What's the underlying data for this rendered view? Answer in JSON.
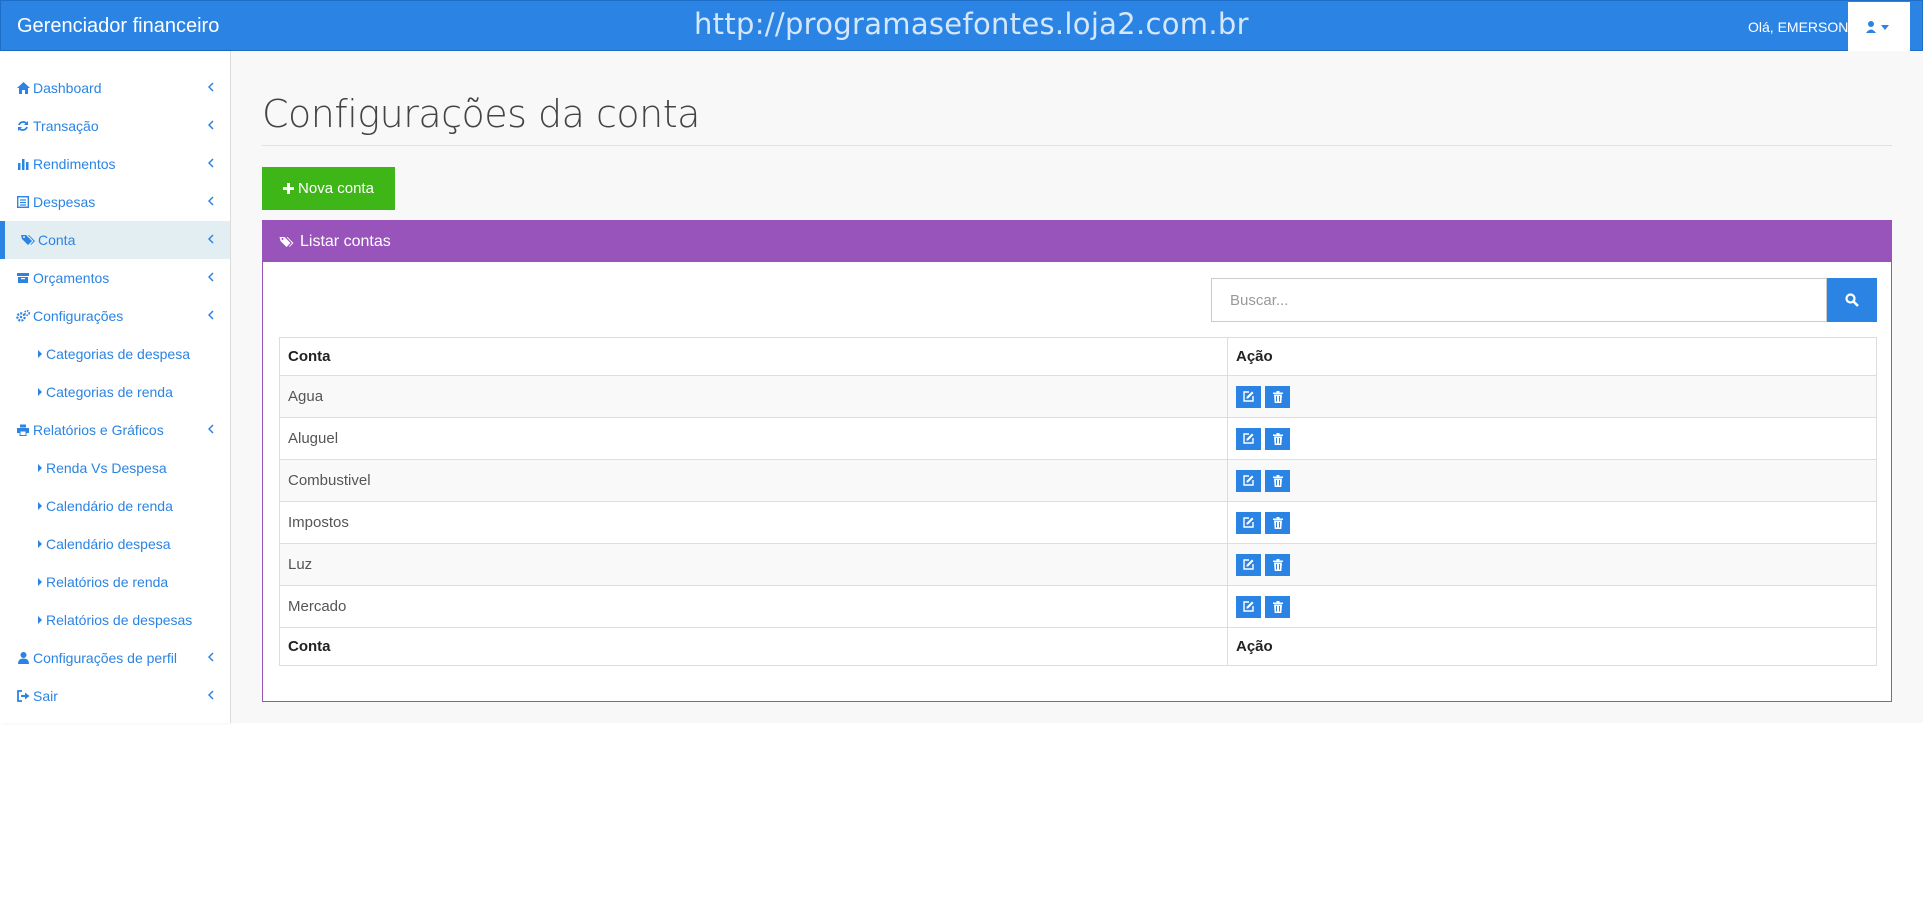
{
  "header": {
    "brand": "Gerenciador financeiro",
    "watermark": "http://programasefontes.loja2.com.br",
    "greeting": "Olá, EMERSON"
  },
  "sidebar": {
    "items": [
      {
        "label": "Dashboard",
        "icon": "home-icon"
      },
      {
        "label": "Transação",
        "icon": "refresh-icon"
      },
      {
        "label": "Rendimentos",
        "icon": "bar-chart-icon"
      },
      {
        "label": "Despesas",
        "icon": "list-icon"
      },
      {
        "label": "Conta",
        "icon": "tags-icon",
        "active": true
      },
      {
        "label": "Orçamentos",
        "icon": "archive-icon"
      },
      {
        "label": "Configurações",
        "icon": "gears-icon"
      },
      {
        "label": "Categorias de despesa",
        "sub": true
      },
      {
        "label": "Categorias de renda",
        "sub": true
      },
      {
        "label": "Relatórios e Gráficos",
        "icon": "print-icon"
      },
      {
        "label": "Renda Vs Despesa",
        "sub": true
      },
      {
        "label": "Calendário de renda",
        "sub": true
      },
      {
        "label": "Calendário despesa",
        "sub": true
      },
      {
        "label": "Relatórios de renda",
        "sub": true
      },
      {
        "label": "Relatórios de despesas",
        "sub": true
      },
      {
        "label": "Configurações de perfil",
        "icon": "user-icon"
      },
      {
        "label": "Sair",
        "icon": "sign-out-icon"
      }
    ]
  },
  "main": {
    "title": "Configurações da conta",
    "new_button": "Nova conta",
    "panel_title": "Listar contas",
    "search_placeholder": "Buscar...",
    "table": {
      "headers": [
        "Conta",
        "Ação"
      ],
      "rows": [
        "Agua",
        "Aluguel",
        "Combustivel",
        "Impostos",
        "Luz",
        "Mercado"
      ],
      "footers": [
        "Conta",
        "Ação"
      ]
    }
  },
  "colors": {
    "primary": "#2b84e3",
    "success": "#3fb618",
    "panel": "#9954bb"
  }
}
